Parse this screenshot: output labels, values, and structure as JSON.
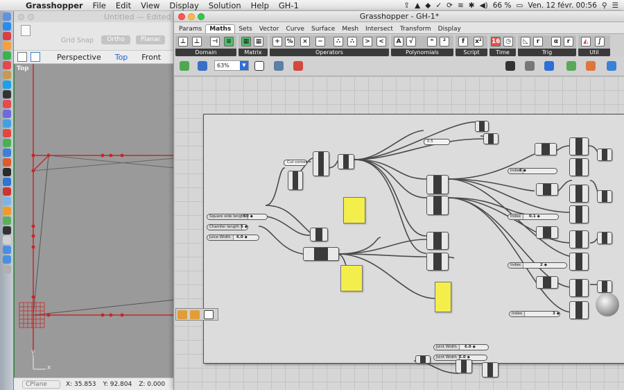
{
  "menubar": {
    "app_name": "Grasshopper",
    "items": [
      "File",
      "Edit",
      "View",
      "Display",
      "Solution",
      "Help",
      "GH-1"
    ],
    "battery": "66 %",
    "datetime": "Ven. 12 févr.  00:56"
  },
  "rhino": {
    "title": "Untitled — Edited",
    "grid_snap": "Grid Snap",
    "ortho": "Ortho",
    "planar": "Planar",
    "views": [
      "Perspective",
      "Top",
      "Front"
    ],
    "active_view": "Top",
    "viewport_label": "Top",
    "axis_y": "y",
    "axis_x": "x",
    "cplane": "CPlane",
    "coord_x": "X: 35.853",
    "coord_y": "Y: 92.804",
    "coord_z": "Z: 0.000"
  },
  "grasshopper": {
    "title": "Grasshopper - GH-1*",
    "tabs": [
      "Params",
      "Maths",
      "Sets",
      "Vector",
      "Curve",
      "Surface",
      "Mesh",
      "Intersect",
      "Transform",
      "Display"
    ],
    "active_tab": "Maths",
    "ribbon_groups": [
      "Domain",
      "Matrix",
      "Operators",
      "Polynomials",
      "Script",
      "Time",
      "Trig",
      "Util"
    ],
    "zoom": "63%",
    "sliders": [
      {
        "label": "Square side length",
        "value": "50 ◆"
      },
      {
        "label": "Chamfer length",
        "value": "5 ◆"
      },
      {
        "label": "Juice Width",
        "value": "6.0 ◆"
      },
      {
        "label": "Index",
        "value": "6 ◆"
      },
      {
        "label": "Index",
        "value": "0.1 ◆"
      },
      {
        "label": "Index",
        "value": "2 ◆"
      },
      {
        "label": "Index",
        "value": "3 ◆"
      },
      {
        "label": "Joint Width",
        "value": "6.0 ◆"
      },
      {
        "label": "Joint Width",
        "value": "5.0 ◆"
      }
    ],
    "text_params": [
      "Cut corner = 0.0.0",
      "0.5"
    ]
  },
  "colors": {
    "panel_yellow": "#f4ee4d",
    "rhino_red": "#c8262b",
    "active_blue": "#2d6fd8"
  }
}
